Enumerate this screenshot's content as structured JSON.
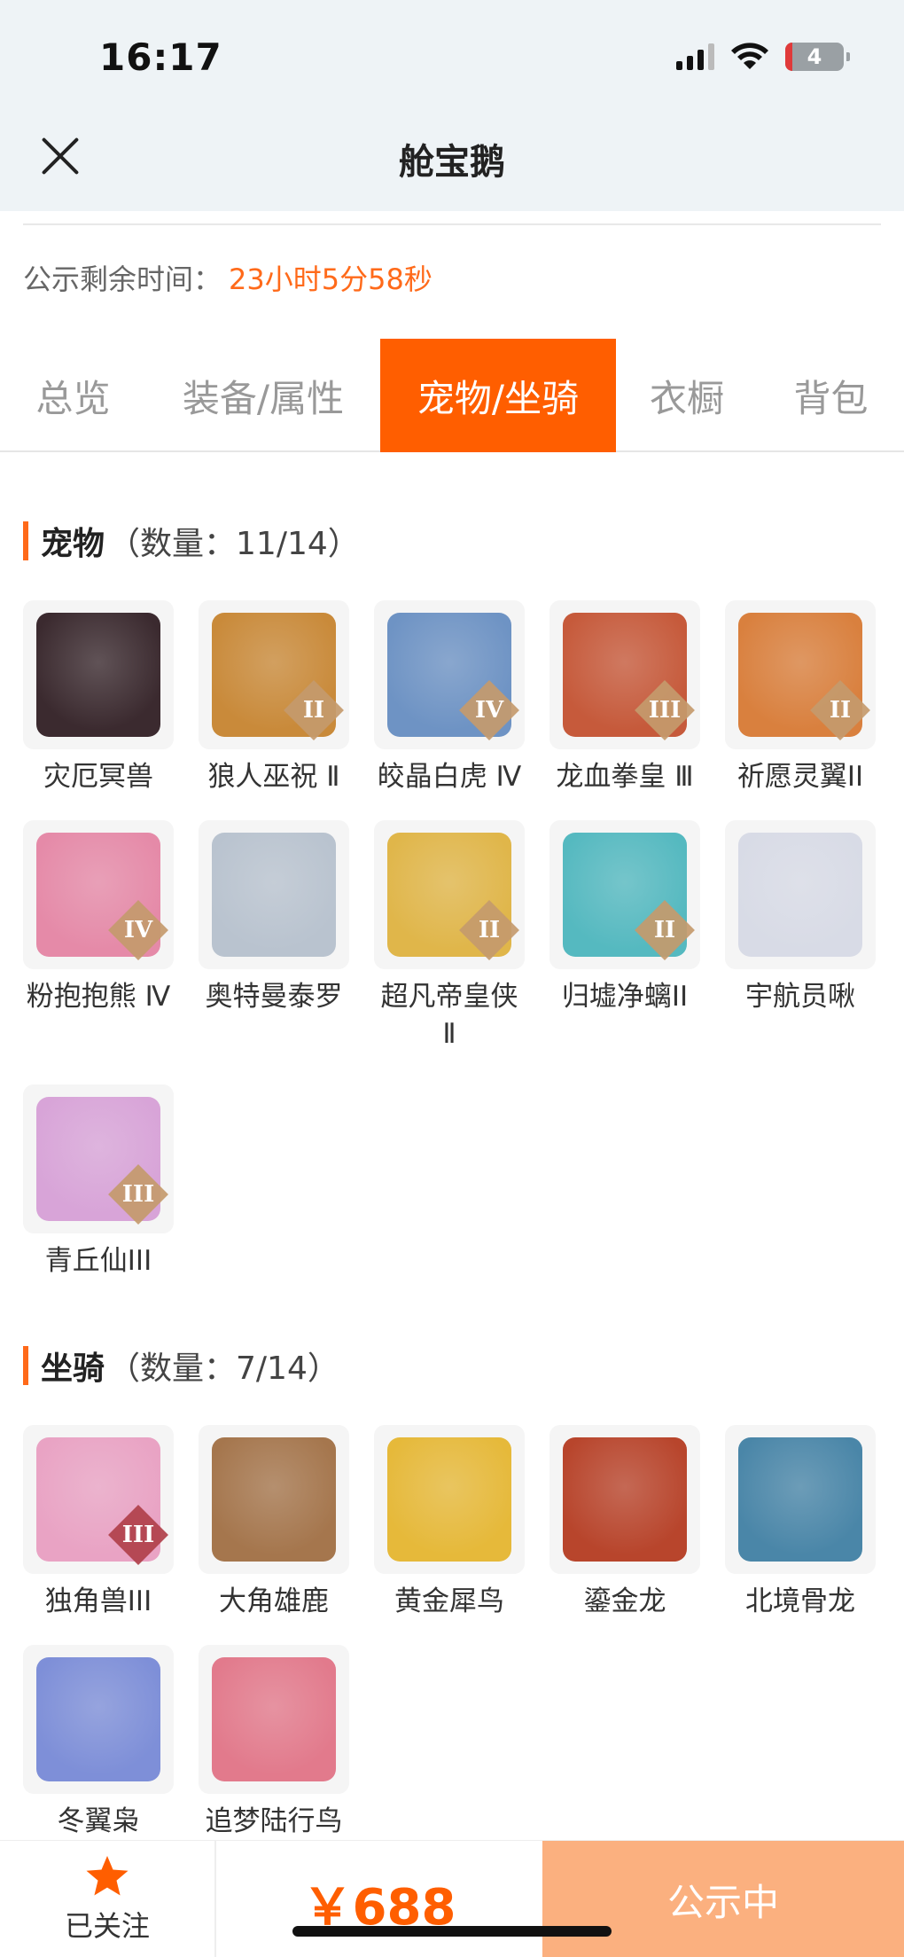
{
  "status_bar": {
    "time": "16:17",
    "battery": "4"
  },
  "header": {
    "title": "舱宝鹅"
  },
  "countdown": {
    "label": "公示剩余时间：",
    "value": "23小时5分58秒"
  },
  "tabs": [
    {
      "label": "总览"
    },
    {
      "label": "装备/属性"
    },
    {
      "label": "宠物/坐骑",
      "active": true
    },
    {
      "label": "衣橱"
    },
    {
      "label": "背包"
    }
  ],
  "pets": {
    "title": "宠物",
    "count": "（数量：11/14）",
    "items": [
      {
        "name": "灾厄冥兽",
        "rank": "",
        "art": "#3b2a2f"
      },
      {
        "name": "狼人巫祝 Ⅱ",
        "rank": "II",
        "art": "#c98a3a"
      },
      {
        "name": "皎晶白虎 Ⅳ",
        "rank": "IV",
        "art": "#6e93c4"
      },
      {
        "name": "龙血拳皇 Ⅲ",
        "rank": "III",
        "art": "#c65a3b"
      },
      {
        "name": "祈愿灵翼II",
        "rank": "II",
        "art": "#d9803e"
      },
      {
        "name": "粉抱抱熊 Ⅳ",
        "rank": "IV",
        "art": "#e58aa8"
      },
      {
        "name": "奥特曼泰罗",
        "rank": "",
        "art": "#b9c3cf"
      },
      {
        "name": "超凡帝皇侠Ⅱ",
        "rank": "II",
        "art": "#e0b64a"
      },
      {
        "name": "归墟净螭II",
        "rank": "II",
        "art": "#55b9c0"
      },
      {
        "name": "宇航员啾",
        "rank": "",
        "art": "#d8dbe6"
      },
      {
        "name": "青丘仙III",
        "rank": "III",
        "art": "#d8a4d8"
      }
    ]
  },
  "mounts": {
    "title": "坐骑",
    "count": "（数量：7/14）",
    "items": [
      {
        "name": "独角兽III",
        "rank": "III",
        "art": "#e9a3c4"
      },
      {
        "name": "大角雄鹿",
        "rank": "",
        "art": "#a5764d"
      },
      {
        "name": "黄金犀鸟",
        "rank": "",
        "art": "#e6b93a"
      },
      {
        "name": "鎏金龙",
        "rank": "",
        "art": "#b8452c"
      },
      {
        "name": "北境骨龙",
        "rank": "",
        "art": "#4a86a8"
      },
      {
        "name": "冬翼枭",
        "rank": "",
        "art": "#7e8fd8"
      },
      {
        "name": "追梦陆行鸟",
        "rank": "",
        "art": "#e27a8c"
      }
    ]
  },
  "bottom_bar": {
    "follow_label": "已关注",
    "price": "￥688",
    "status_label": "公示中"
  }
}
